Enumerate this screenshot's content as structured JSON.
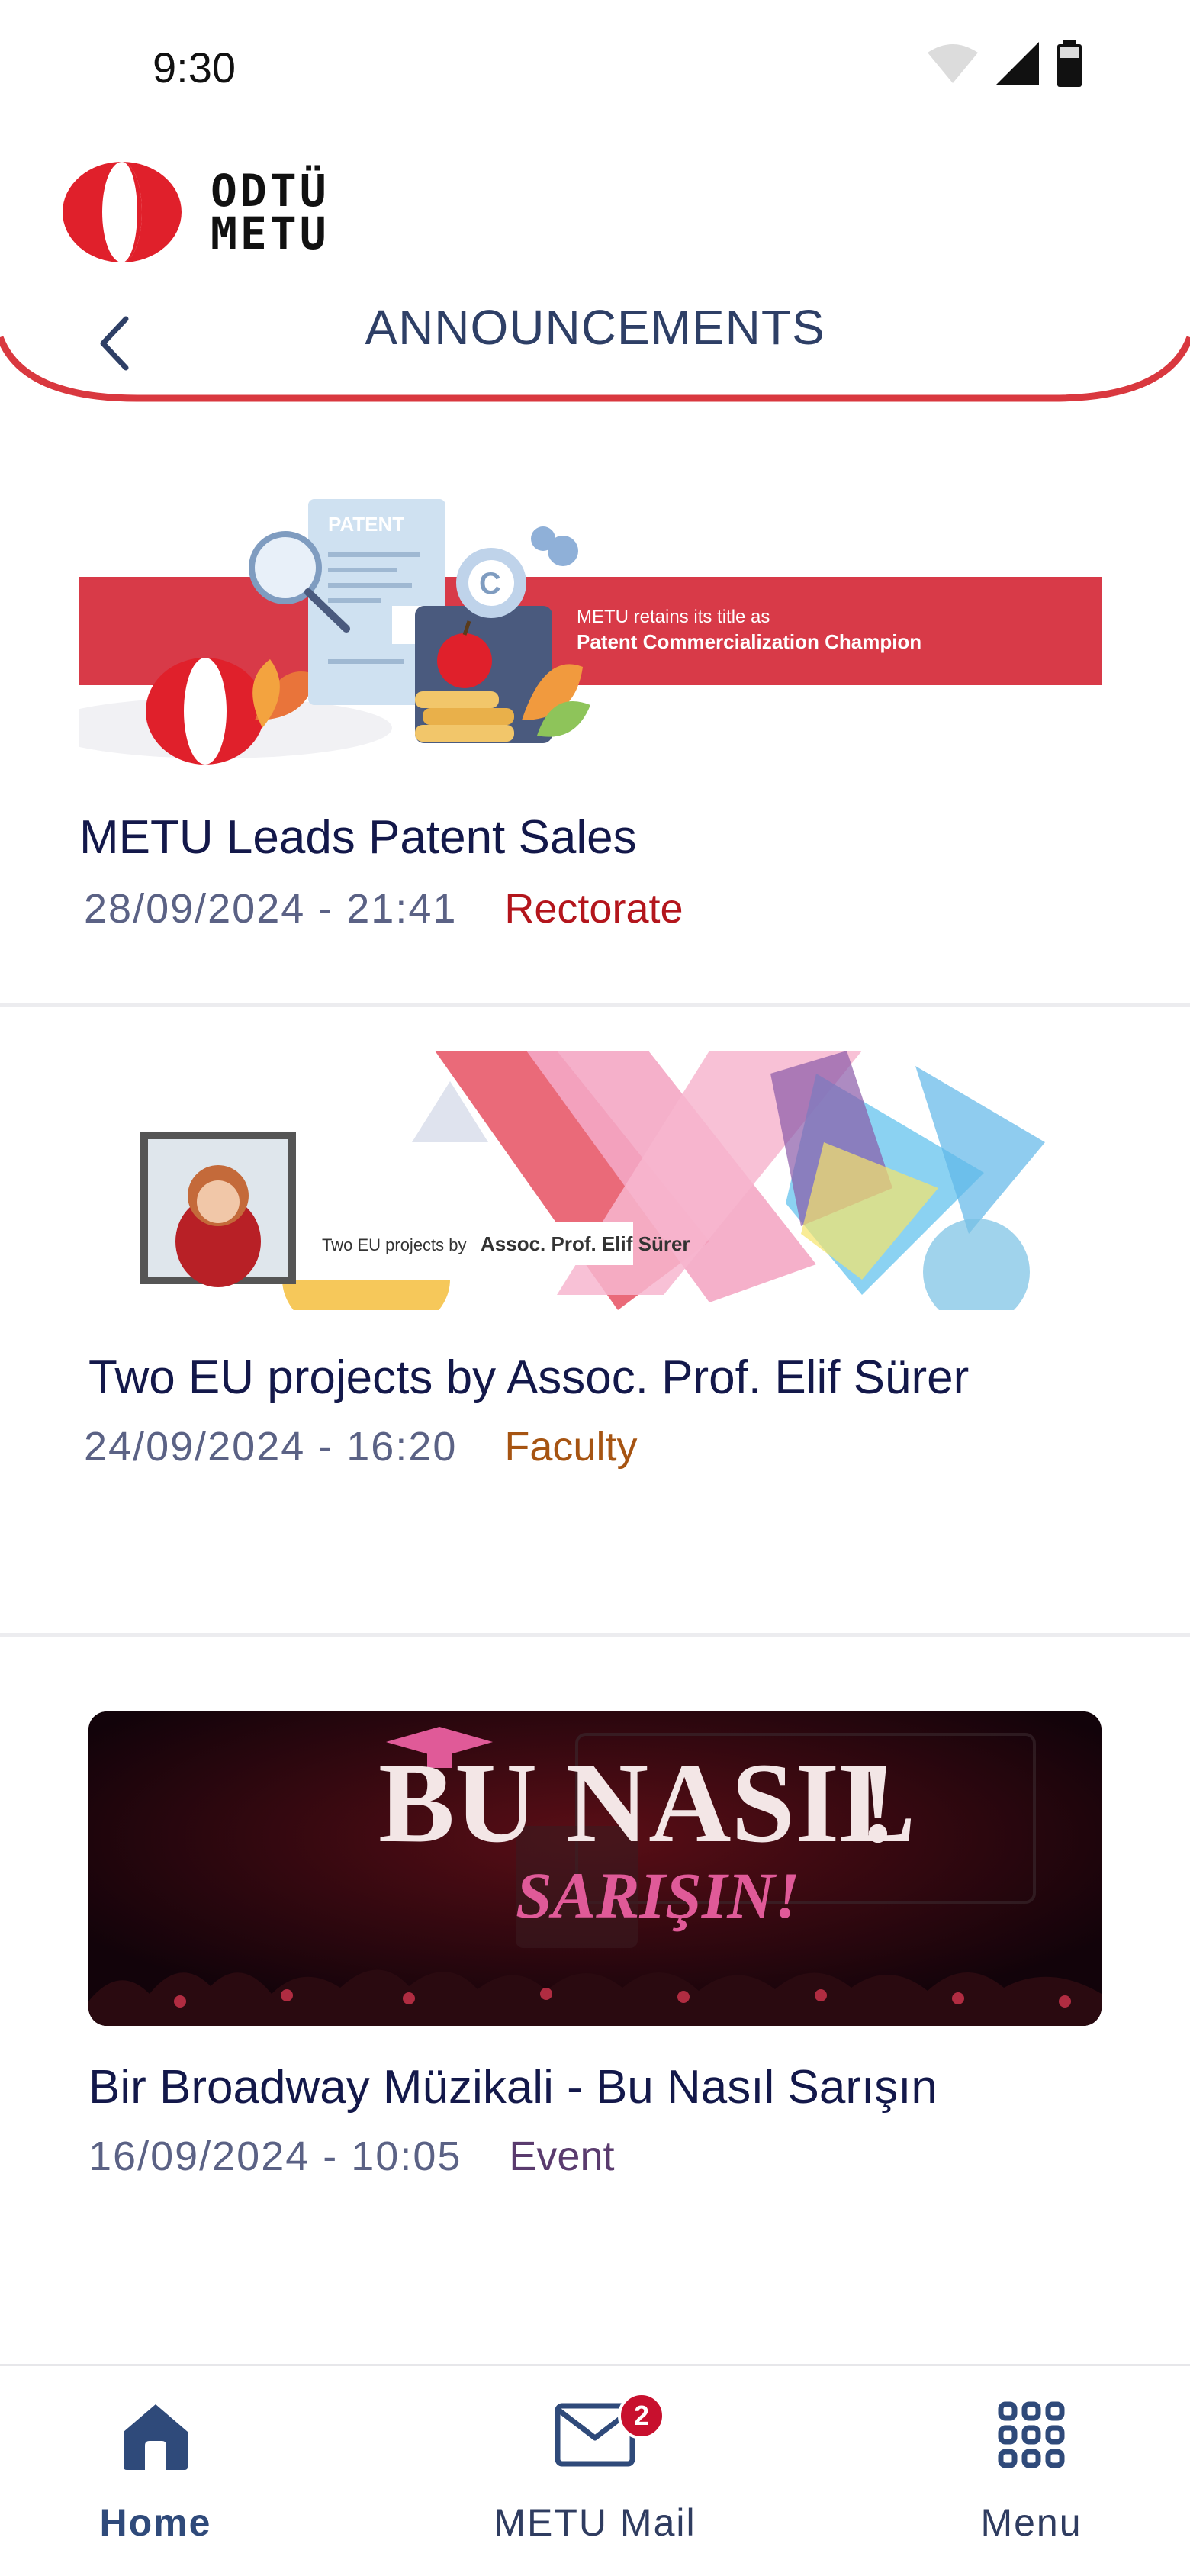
{
  "status_bar": {
    "time": "9:30"
  },
  "header": {
    "logo_line1": "ODTÜ",
    "logo_line2": "METU",
    "title": "ANNOUNCEMENTS",
    "accent_color": "#d9383f"
  },
  "announcements": [
    {
      "title": "METU Leads Patent Sales",
      "date": "28/09/2024 - 21:41",
      "category": "Rectorate",
      "category_color": "#b3151c",
      "image": {
        "label_tag": "PATENT",
        "banner_line1": "METU retains its title as",
        "banner_line2": "Patent Commercialization Champion"
      }
    },
    {
      "title": "Two EU projects by Assoc. Prof. Elif Sürer",
      "date": "24/09/2024 - 16:20",
      "category": "Faculty",
      "category_color": "#a65412",
      "image": {
        "caption_prefix": "Two EU projects by ",
        "caption_name": "Assoc. Prof. Elif Sürer"
      }
    },
    {
      "title": "Bir Broadway Müzikali - Bu Nasıl Sarışın",
      "date": "16/09/2024 - 10:05",
      "category": "Event",
      "category_color": "#5a3b6e",
      "image": {
        "headline": "BU NASIL",
        "subheadline": "SARIŞIN!"
      }
    }
  ],
  "bottom_nav": {
    "items": [
      {
        "label": "Home",
        "icon": "home-icon",
        "active": true
      },
      {
        "label": "METU Mail",
        "icon": "mail-icon",
        "badge": "2"
      },
      {
        "label": "Menu",
        "icon": "grid-icon"
      }
    ]
  }
}
